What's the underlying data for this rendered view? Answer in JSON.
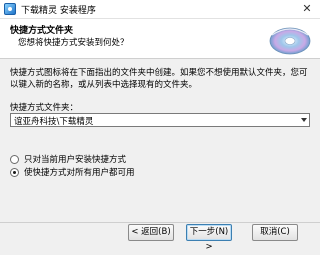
{
  "window": {
    "title": "下载精灵 安装程序",
    "close_symbol": "✕"
  },
  "header": {
    "title": "快捷方式文件夹",
    "subtitle": "您想将快捷方式安装到何处？"
  },
  "content": {
    "description": "快捷方式图标将在下面指出的文件夹中创建。如果您不想使用默认文件夹，您可以键入新的名称，或从列表中选择现有的文件夹。",
    "field_label": "快捷方式文件夹：",
    "folder_value": "谊亚舟科技\\下载精灵",
    "radio_options": [
      {
        "label": "只对当前用户安装快捷方式",
        "checked": false
      },
      {
        "label": "使快捷方式对所有用户都可用",
        "checked": true
      }
    ]
  },
  "footer": {
    "brand": "",
    "back_label": "< 返回(B)",
    "next_label": "下一步(N) >",
    "cancel_label": "取消(C)"
  },
  "icons": {
    "app": "app-icon",
    "disc": "disc-icon",
    "close": "close-icon"
  }
}
